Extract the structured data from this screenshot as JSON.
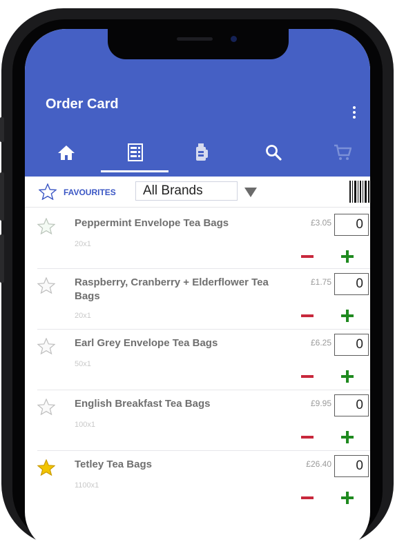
{
  "app": {
    "title": "Order Card",
    "tabs": [
      {
        "name": "home",
        "icon": "home-icon"
      },
      {
        "name": "order-card",
        "icon": "order-card-icon",
        "active": true
      },
      {
        "name": "categories",
        "icon": "category-icon"
      },
      {
        "name": "search",
        "icon": "search-icon"
      },
      {
        "name": "cart",
        "icon": "cart-icon"
      }
    ],
    "colors": {
      "appbar": "#4560c4",
      "accent": "#3a56c4",
      "minus": "#c8283c",
      "plus": "#1f8a1f",
      "star_active": "#f2c400"
    }
  },
  "filter": {
    "favourites_label": "FAVOURITES",
    "brand_selected": "All Brands"
  },
  "products": [
    {
      "name": "Peppermint Envelope Tea Bags",
      "pack": "20x1",
      "price": "£3.05",
      "qty": "0",
      "favourite": false
    },
    {
      "name": "Raspberry, Cranberry + Elderflower Tea Bags",
      "pack": "20x1",
      "price": "£1.75",
      "qty": "0",
      "favourite": false
    },
    {
      "name": "Earl Grey Envelope Tea Bags",
      "pack": "50x1",
      "price": "£6.25",
      "qty": "0",
      "favourite": false
    },
    {
      "name": "English Breakfast Tea Bags",
      "pack": "100x1",
      "price": "£9.95",
      "qty": "0",
      "favourite": false
    },
    {
      "name": "Tetley Tea Bags",
      "pack": "1100x1",
      "price": "£26.40",
      "qty": "0",
      "favourite": true
    }
  ]
}
